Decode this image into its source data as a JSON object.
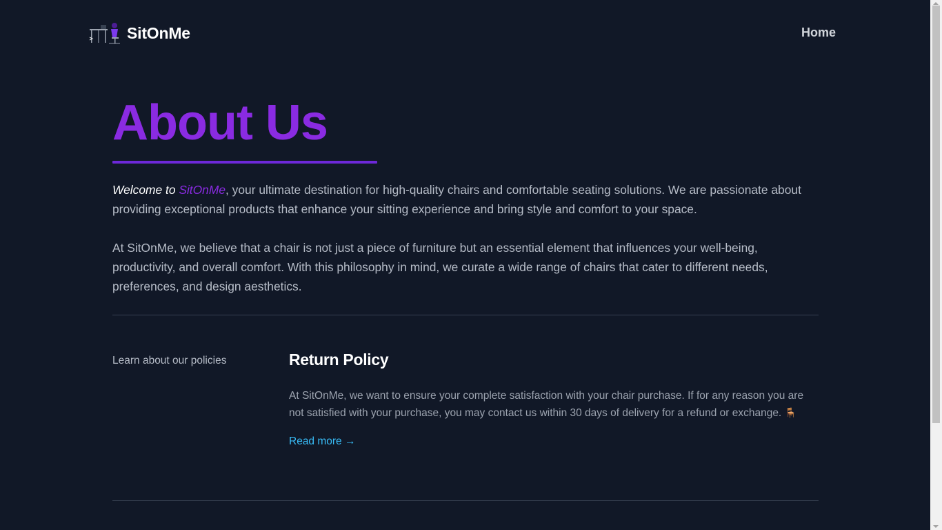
{
  "header": {
    "brand": "SitOnMe",
    "logo_icon": "desk-chair-person-icon",
    "nav": {
      "home_label": "Home"
    }
  },
  "main": {
    "title": "About Us",
    "intro": {
      "welcome_prefix": "Welcome to",
      "brand": "SitOnMe",
      "p1_rest": ", your ultimate destination for high-quality chairs and comfortable seating solutions. We are passionate about providing exceptional products that enhance your sitting experience and bring style and comfort to your space.",
      "p2": "At SitOnMe, we believe that a chair is not just a piece of furniture but an essential element that influences your well-being, productivity, and overall comfort. With this philosophy in mind, we curate a wide range of chairs that cater to different needs, preferences, and design aesthetics."
    },
    "policies": {
      "label": "Learn about our policies",
      "items": [
        {
          "title": "Return Policy",
          "body": "At SitOnMe, we want to ensure your complete satisfaction with your chair purchase. If for any reason you are not satisfied with your purchase, you may contact us within 30 days of delivery for a refund or exchange.",
          "emoji": "🪑",
          "link": "Read more →"
        }
      ]
    }
  },
  "colors": {
    "background": "#111827",
    "accent_purple": "#8a2be2",
    "link_blue": "#38bdf8"
  }
}
